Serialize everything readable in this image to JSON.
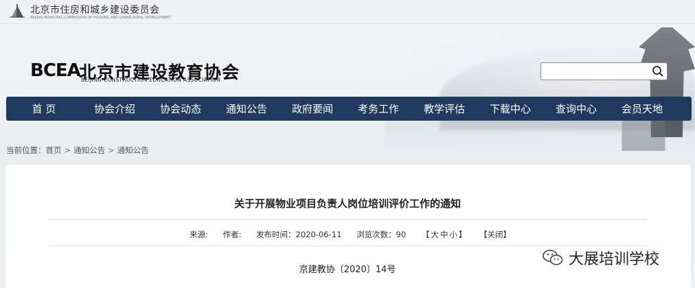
{
  "header": {
    "commission_name": "北京市住房和城乡建设委员会",
    "commission_en": "BEIJING MUNICIPAL COMMISSION OF HOUSING AND URBAN-RURAL DEVELOPMENT",
    "brand_mark": "BCEA",
    "brand_name": "北京市建设教育协会",
    "brand_en": "BEIJING CONSTRUCTION EDUCATION ASSOCIATION"
  },
  "search": {
    "value": "",
    "placeholder": ""
  },
  "nav": {
    "items": [
      "首 页",
      "协会介绍",
      "协会动态",
      "通知公告",
      "政府要闻",
      "考务工作",
      "教学评估",
      "下载中心",
      "查询中心",
      "会员天地"
    ]
  },
  "breadcrumb": {
    "prefix": "当前位置：",
    "items": [
      "首页",
      "通知公告",
      "通知公告"
    ],
    "separator": ">"
  },
  "article": {
    "title": "关于开展物业项目负责人岗位培训评价工作的通知",
    "meta": {
      "source_label": "来源:",
      "author_label": "作者:",
      "date_label": "发布时间：2020-06-11",
      "views_label": "浏览次数：90",
      "size_open": "【",
      "size_large": "大",
      "size_medium": "中",
      "size_small": "小",
      "size_close": "】",
      "close_label": "【关闭】"
    },
    "doc_number": "京建教协〔2020〕14号"
  },
  "watermark": {
    "text": "大展培训学校"
  },
  "colors": {
    "nav_bg": "#1f3a5e",
    "nav_text": "#ffffff"
  }
}
